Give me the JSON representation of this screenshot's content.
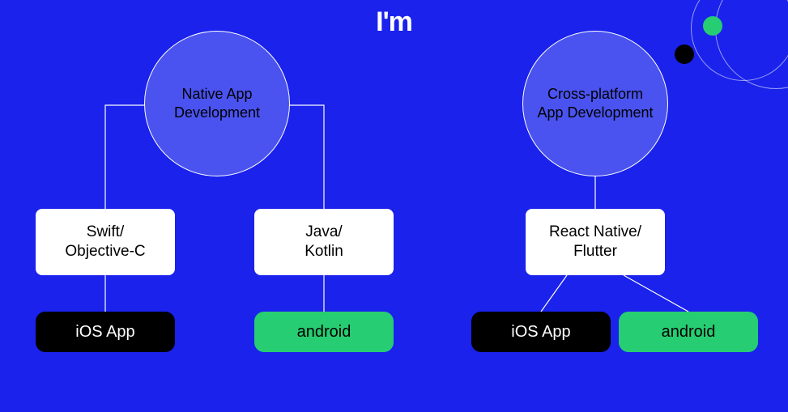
{
  "logo": "I'm",
  "colors": {
    "background": "#1a22ec",
    "circle_fill": "#4a53ef",
    "pill_black": "#000000",
    "pill_green": "#27cd72",
    "box_white": "#ffffff"
  },
  "diagram": {
    "left": {
      "title": "Native App\nDevelopment",
      "children": [
        {
          "tech": "Swift/\nObjective-C",
          "platform": "iOS App",
          "platform_style": "black"
        },
        {
          "tech": "Java/\nKotlin",
          "platform": "android",
          "platform_style": "green"
        }
      ]
    },
    "right": {
      "title": "Cross-platform\nApp Development",
      "children": [
        {
          "tech": "React Native/\nFlutter",
          "platforms": [
            {
              "label": "iOS App",
              "style": "black"
            },
            {
              "label": "android",
              "style": "green"
            }
          ]
        }
      ]
    }
  }
}
